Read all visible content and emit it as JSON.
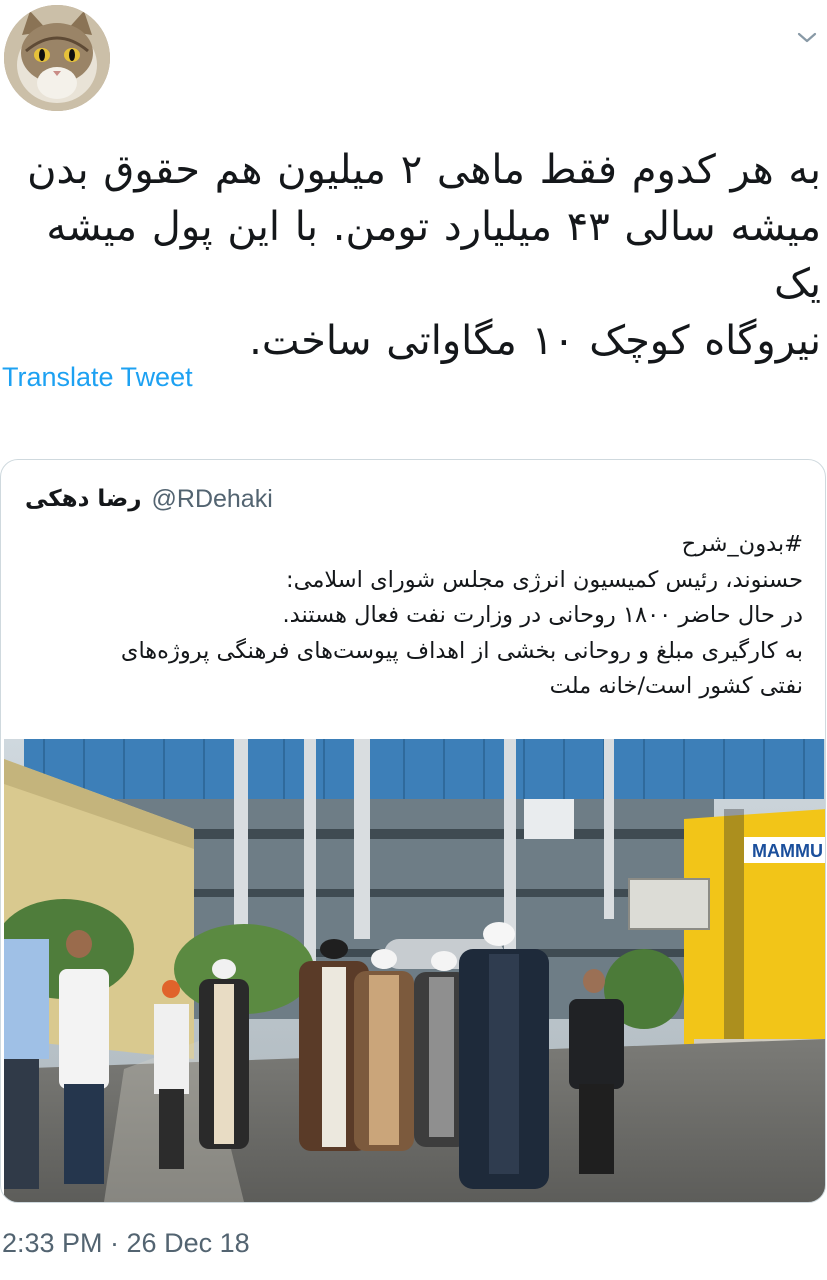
{
  "tweet": {
    "avatar_icon": "cat-avatar-icon",
    "menu_icon": "chevron-down-icon",
    "text_lines": [
      "به هر کدوم فقط ماهی ۲ میلیون هم حقوق بدن",
      "میشه سالی ۴۳ میلیارد تومن. با این پول میشه یک",
      "نیروگاه کوچک ۱۰ مگاواتی ساخت."
    ],
    "translate_label": "Translate Tweet",
    "timestamp": "2:33 PM · 26 Dec 18"
  },
  "quoted_tweet": {
    "author_name": "رضا دهکی",
    "author_handle": "@RDehaki",
    "body_lines": [
      "#بدون_شرح",
      "حسنوند، رئیس کمیسیون انرژی مجلس شورای اسلامی:",
      "در حال حاضر ۱۸۰۰ روحانی در وزارت نفت فعال هستند.",
      "به کارگیری مبلغ و روحانی بخشی از اهداف پیوست‌های فرهنگی پروژه‌های",
      "نفتی کشور است/خانه ملت"
    ],
    "image": {
      "sign_text": "MAMMU",
      "colors": {
        "building_blue": "#3d7fb8",
        "container_yellow": "#f2c518",
        "ground": "#6f6f6b"
      }
    }
  },
  "colors": {
    "link_blue": "#1da1f2",
    "text_primary": "#14171a",
    "text_secondary": "#536471",
    "card_border": "#cfd9de"
  }
}
